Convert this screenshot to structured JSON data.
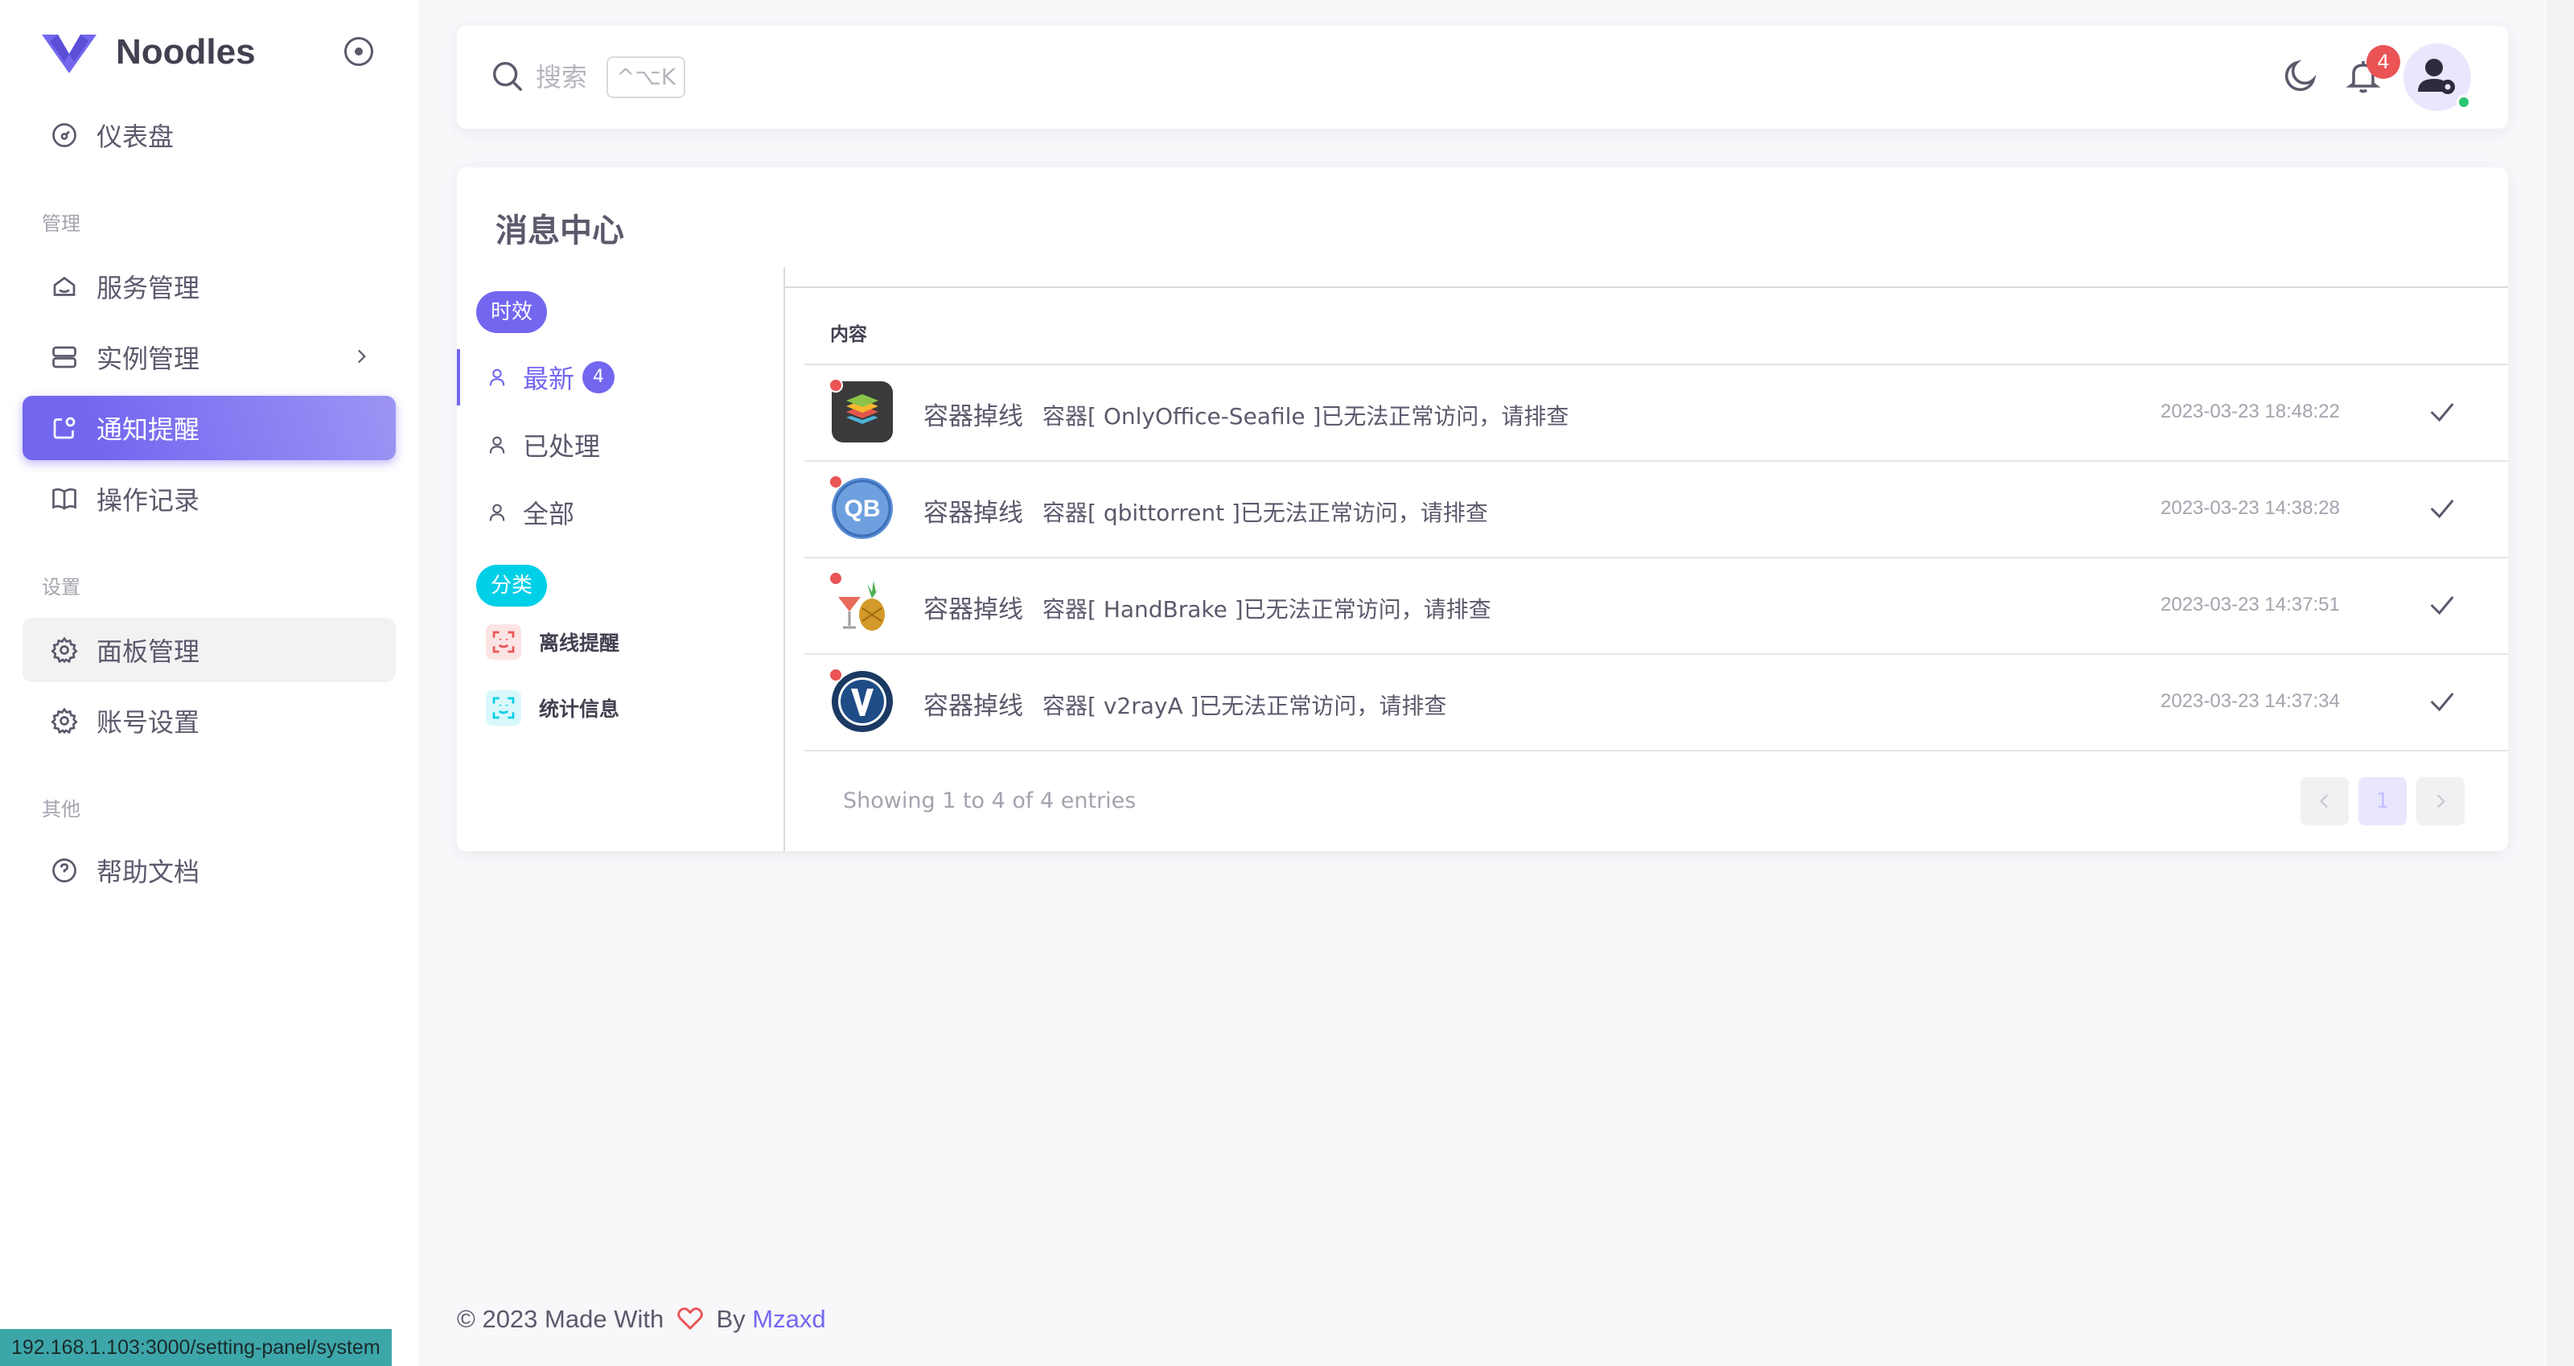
{
  "brand": {
    "name": "Noodles",
    "color": "#7367f0"
  },
  "sidebar": {
    "items": [
      {
        "label": "仪表盘",
        "icon": "dashboard-icon"
      },
      {
        "label": "服务管理",
        "icon": "home-icon"
      },
      {
        "label": "实例管理",
        "icon": "server-icon"
      },
      {
        "label": "通知提醒",
        "icon": "notification-icon"
      },
      {
        "label": "操作记录",
        "icon": "book-icon"
      },
      {
        "label": "面板管理",
        "icon": "gear-icon"
      },
      {
        "label": "账号设置",
        "icon": "gear-icon"
      },
      {
        "label": "帮助文档",
        "icon": "help-icon"
      }
    ],
    "sections": [
      "管理",
      "设置",
      "其他"
    ],
    "active_item": "通知提醒"
  },
  "topbar": {
    "search_placeholder": "搜索",
    "shortcut": "^⌥K",
    "notification_count": "4"
  },
  "card": {
    "title": "消息中心",
    "filter_group_label": "时效",
    "filters": [
      {
        "label": "最新",
        "count": "4"
      },
      {
        "label": "已处理"
      },
      {
        "label": "全部"
      }
    ],
    "category_group_label": "分类",
    "categories": [
      {
        "label": "离线提醒",
        "color": "#ea5455"
      },
      {
        "label": "统计信息",
        "color": "#00cfe8"
      }
    ],
    "column_header": "内容",
    "messages": [
      {
        "title": "容器掉线",
        "text": "容器[ OnlyOffice-Seafile ]已无法正常访问，请排查",
        "time": "2023-03-23 18:48:22",
        "icon": "onlyoffice-icon"
      },
      {
        "title": "容器掉线",
        "text": "容器[ qbittorrent ]已无法正常访问，请排查",
        "time": "2023-03-23 14:38:28",
        "icon": "qbittorrent-icon"
      },
      {
        "title": "容器掉线",
        "text": "容器[ HandBrake ]已无法正常访问，请排查",
        "time": "2023-03-23 14:37:51",
        "icon": "handbrake-icon"
      },
      {
        "title": "容器掉线",
        "text": "容器[ v2rayA ]已无法正常访问，请排查",
        "time": "2023-03-23 14:37:34",
        "icon": "v2raya-icon"
      }
    ],
    "entries_text": "Showing 1 to 4 of 4 entries",
    "current_page": "1"
  },
  "footer": {
    "prefix": "© 2023 Made With",
    "by": "By",
    "author": "Mzaxd"
  },
  "statusbar": {
    "url": "192.168.1.103:3000/setting-panel/system"
  }
}
